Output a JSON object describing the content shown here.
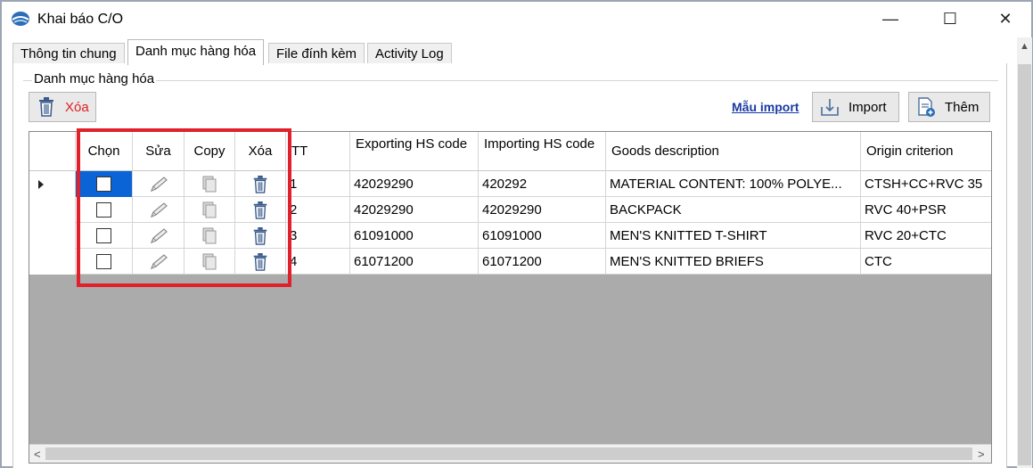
{
  "window": {
    "title": "Khai báo C/O",
    "min_glyph": "—",
    "max_glyph": "☐",
    "close_glyph": "✕"
  },
  "tabs": [
    {
      "label": "Thông tin chung",
      "active": false
    },
    {
      "label": "Danh mục hàng hóa",
      "active": true
    },
    {
      "label": "File đính kèm",
      "active": false
    },
    {
      "label": "Activity Log",
      "active": false
    }
  ],
  "group": {
    "legend": "Danh mục hàng hóa"
  },
  "toolbar": {
    "delete_label": "Xóa",
    "template_link": "Mẫu import",
    "import_label": "Import",
    "add_label": "Thêm"
  },
  "grid": {
    "columns": {
      "select": "Chọn",
      "edit": "Sửa",
      "copy": "Copy",
      "delete": "Xóa",
      "no": "TT",
      "exporting_hs": "Exporting HS code",
      "importing_hs": "Importing HS code",
      "description": "Goods description",
      "origin": "Origin criterion"
    },
    "rows": [
      {
        "no": "1",
        "exporting_hs": "42029290",
        "importing_hs": "420292",
        "description": "MATERIAL CONTENT: 100% POLYE...",
        "origin": "CTSH+CC+RVC 35"
      },
      {
        "no": "2",
        "exporting_hs": "42029290",
        "importing_hs": "42029290",
        "description": "BACKPACK",
        "origin": "RVC 40+PSR"
      },
      {
        "no": "3",
        "exporting_hs": "61091000",
        "importing_hs": "61091000",
        "description": "MEN'S KNITTED T-SHIRT",
        "origin": "RVC 20+CTC"
      },
      {
        "no": "4",
        "exporting_hs": "61071200",
        "importing_hs": "61071200",
        "description": "MEN'S KNITTED BRIEFS",
        "origin": "CTC"
      }
    ],
    "scroll_left": "<",
    "scroll_right": ">"
  },
  "colors": {
    "highlight": "#e0202a",
    "selection": "#0a64d6",
    "link": "#1a3aa3",
    "delete_text": "#e02020"
  },
  "icons": {
    "app": "app-globe-icon",
    "pencil": "pencil-icon",
    "copy": "copy-icon",
    "trash": "trash-icon",
    "import": "import-icon",
    "add": "add-document-icon"
  }
}
